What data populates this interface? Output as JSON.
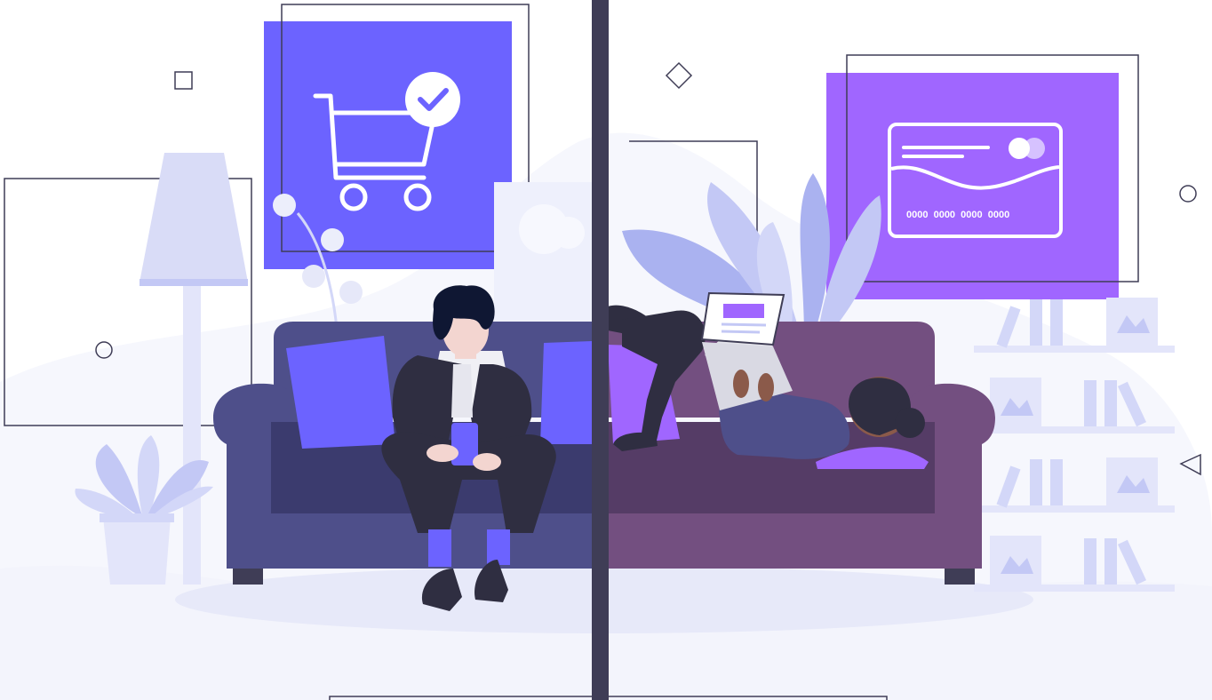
{
  "scene": {
    "description_free": true,
    "card_number": "0000  0000  0000  0000",
    "colors": {
      "background": "#ffffff",
      "backdrop": "#f6f7fd",
      "floor_shadow": "#e7e9f9",
      "divider": "#3f3d56",
      "shopping_panel": "#6c63ff",
      "payment_panel": "#a066ff",
      "left_sofa": "#4e4f8a",
      "left_sofa_dark": "#3b3b6e",
      "right_sofa": "#734f80",
      "right_sofa_dark": "#553c66",
      "cushion_blue": "#6c63ff",
      "cushion_purple": "#a066ff",
      "lamp": "#d9dcf7",
      "plant": "#c3c8f5",
      "skin": "#f3d5d0",
      "hair": "#0f1733",
      "suit": "#2f2e41"
    },
    "icons": [
      "shopping-cart-icon",
      "checkmark-icon",
      "credit-card-icon"
    ]
  }
}
